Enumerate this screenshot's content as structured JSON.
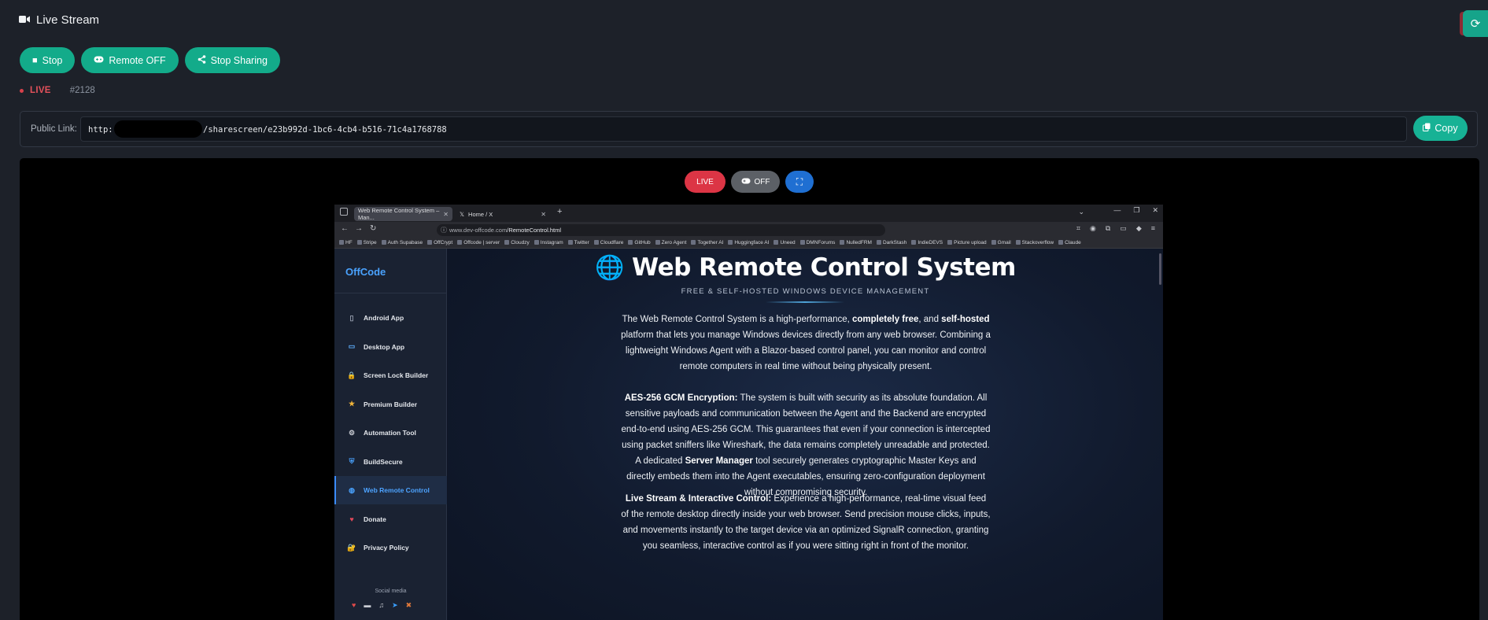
{
  "header": {
    "title": "Live Stream"
  },
  "controls": {
    "stop": "Stop",
    "remote": "Remote OFF",
    "share": "Stop Sharing"
  },
  "status": {
    "live": "LIVE",
    "session": "#2128"
  },
  "link": {
    "label": "Public Link:",
    "protocol": "http:",
    "path": "/sharescreen/e23b992d-1bc6-4cb4-b516-71c4a1768788",
    "copy": "Copy"
  },
  "overlay": {
    "live": "LIVE",
    "remote": "OFF"
  },
  "browser": {
    "tabs": [
      "Web Remote Control System – Man...",
      "Home / X"
    ],
    "url_host": "www.dev-offcode.com",
    "url_path": "/RemoteControl.html",
    "bookmarks": [
      "HF",
      "Stripe",
      "Auth Supabase",
      "OffCrypt",
      "Offcode | server",
      "Cloudzy",
      "Instagram",
      "Twitter",
      "Cloudflare",
      "GitHub",
      "Zero Agent",
      "Together AI",
      "Huggingface AI",
      "Uneed",
      "DMNForums",
      "NulledFRM",
      "DarkStash",
      "IndieDEVS",
      "Picture upload",
      "Gmail",
      "Stackoverflow",
      "Claude"
    ]
  },
  "site": {
    "brand": "OffCode",
    "nav": [
      {
        "label": "Android App",
        "icon": "phone-icon"
      },
      {
        "label": "Desktop App",
        "icon": "monitor-icon"
      },
      {
        "label": "Screen Lock Builder",
        "icon": "lock-icon"
      },
      {
        "label": "Premium Builder",
        "icon": "star-icon"
      },
      {
        "label": "Automation Tool",
        "icon": "robot-icon"
      },
      {
        "label": "BuildSecure",
        "icon": "shield-icon"
      },
      {
        "label": "Web Remote Control",
        "icon": "globe-icon"
      },
      {
        "label": "Donate",
        "icon": "heart-icon"
      },
      {
        "label": "Privacy Policy",
        "icon": "lock-doc-icon"
      }
    ],
    "social_label": "Social media",
    "title": "Web Remote Control System",
    "subtitle": "FREE & SELF-HOSTED WINDOWS DEVICE MANAGEMENT",
    "p1": {
      "a": "The Web Remote Control System is a high-performance, ",
      "b1": "completely free",
      "c": ", and ",
      "b2": "self-hosted",
      "d": " platform that lets you manage Windows devices directly from any web browser. Combining a lightweight Windows Agent with a Blazor-based control panel, you can monitor and control remote computers in real time without being physically present."
    },
    "p2": {
      "b1": "AES-256 GCM Encryption:",
      "a": " The system is built with security as its absolute foundation. All sensitive payloads and communication between the Agent and the Backend are encrypted end-to-end using AES-256 GCM. This guarantees that even if your connection is intercepted using packet sniffers like Wireshark, the data remains completely unreadable and protected. A dedicated ",
      "b2": "Server Manager",
      "c": " tool securely generates cryptographic Master Keys and directly embeds them into the Agent executables, ensuring zero-configuration deployment without compromising security."
    },
    "p3": {
      "b1": "Live Stream & Interactive Control:",
      "a": " Experience a high-performance, real-time visual feed of the remote desktop directly inside your web browser. Send precision mouse clicks, inputs, and movements instantly to the target device via an optimized SignalR connection, granting you seamless, interactive control as if you were sitting right in front of the monitor."
    }
  },
  "colors": {
    "accent": "#13ab8a",
    "live": "#dc3545",
    "link": "#4aa3ff"
  }
}
